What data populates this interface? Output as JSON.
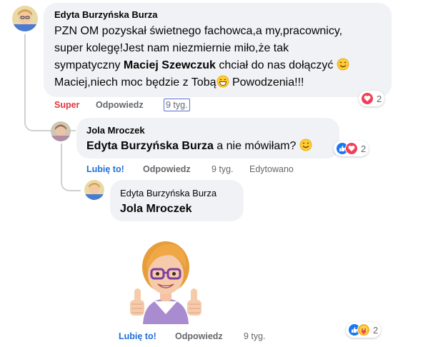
{
  "comment1": {
    "author": "Edyta Burzyńska Burza",
    "lines": [
      "PZN OM pozyskał świetnego fachowca,a my,pracownicy,",
      "super kolegę!Jest nam niezmiernie miło,że tak"
    ],
    "line3_pre": "sympatyczny ",
    "mention": "Maciej Szewczuk",
    "line3_post": " chciał do nas dołączyć",
    "line4_pre": "Maciej,niech moc będzie z Tobą",
    "line4_post": " Powodzenia!!!",
    "reaction_label": "Super",
    "reply_label": "Odpowiedz",
    "time": "9 tyg.",
    "reaction_count": "2"
  },
  "comment2": {
    "author": "Jola Mroczek",
    "mention": "Edyta Burzyńska Burza",
    "text": " a nie mówiłam? ",
    "like_label": "Lubię to!",
    "reply_label": "Odpowiedz",
    "time": "9 tyg.",
    "edited": "Edytowano",
    "reaction_count": "2"
  },
  "comment3": {
    "author": "Edyta Burzyńska Burza",
    "mention": "Jola Mroczek",
    "like_label": "Lubię to!",
    "reply_label": "Odpowiedz",
    "time": "9 tyg.",
    "reaction_count": "2"
  },
  "icons": {
    "smile": "smiling-face-emoji",
    "like": "like-thumb-icon",
    "love": "love-heart-icon",
    "care": "care-hug-icon",
    "sticker": "thumbs-up-avatar-sticker"
  },
  "colors": {
    "bubble": "#f0f2f5",
    "action_gray": "#65676b",
    "like_blue": "#216fdb",
    "super_red": "#e4343b",
    "reaction_like": "#1877f2",
    "reaction_love": "#f33e58"
  }
}
